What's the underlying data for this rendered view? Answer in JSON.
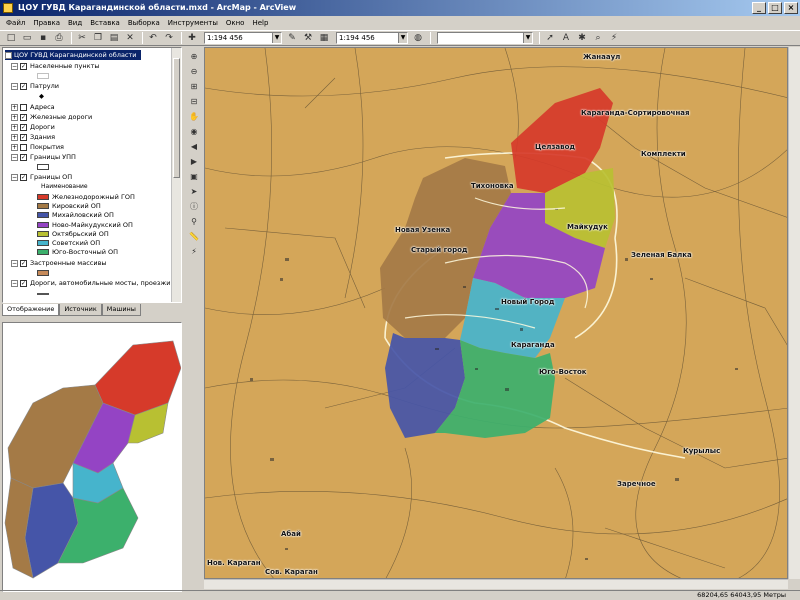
{
  "window": {
    "title": "ЦОУ ГУВД Карагандинской области.mxd - ArcMap - ArcView"
  },
  "menu": [
    "Файл",
    "Правка",
    "Вид",
    "Вставка",
    "Выборка",
    "Инструменты",
    "Окно",
    "Help"
  ],
  "toolbar": {
    "scale1": "1:194 456",
    "scale2": "1:194 456",
    "combo3": ""
  },
  "toc": {
    "root": "ЦОУ ГУВД Карагандинской области",
    "naselennye": "Населенные пункты",
    "patrul": "Патрули",
    "adresa": "Адреса",
    "zhd": "Железные дороги",
    "dorogi": "Дороги",
    "zdaniya": "Здания",
    "pokrytiya": "Покрытия",
    "granitsy_upp": "Границы УПП",
    "granitsy_op": "Границы ОП",
    "naimenovanie": "Наименование",
    "legend": [
      {
        "label": "Железнодорожный ГОП",
        "color": "#d63a2a"
      },
      {
        "label": "Кировский ОП",
        "color": "#a47a46"
      },
      {
        "label": "Михайловский ОП",
        "color": "#4555a8"
      },
      {
        "label": "Ново-Майкудукский ОП",
        "color": "#9444c4"
      },
      {
        "label": "Октябрьский ОП",
        "color": "#b8c032"
      },
      {
        "label": "Советский ОП",
        "color": "#46b4cc"
      },
      {
        "label": "Юго-Восточный ОП",
        "color": "#3cb06c"
      }
    ],
    "zastroennye": "Застроенные массивы",
    "dorogi_mosty": "Дороги, автомобильные мосты, проезжи"
  },
  "tabs": {
    "display": "Отображение",
    "source": "Источник",
    "machines": "Машины"
  },
  "map_labels": {
    "zhanaaul": "Жанааул",
    "karaganda_sort": "Караганда-Сортировочная",
    "tsentrozavod": "Целзавод",
    "komplekt": "Комплекти",
    "tikhonovka": "Тихоновка",
    "novaya_uzenka": "Новая Узенка",
    "maikuduk": "Майкудук",
    "stary_gorod": "Старый город",
    "zelenaya_balka": "Зеленая Балка",
    "novy_gorod": "Новый Город",
    "karaganda": "Караганда",
    "yugo_vostok": "Юго-Восток",
    "kurylys": "Курылыс",
    "zarechnoe": "Заречное",
    "abai": "Абай",
    "nov_karagan": "Нов. Караган",
    "sov_karagan": "Сов. Караган"
  },
  "status": {
    "coords": "68204,65  64043,95 Метры"
  },
  "colors": {
    "map_bg": "#d4a659",
    "zhd": "#d63a2a",
    "kirov": "#a47a46",
    "mikh": "#4555a8",
    "novomaik": "#9444c4",
    "oktyabr": "#b8c032",
    "sovet": "#46b4cc",
    "yugovost": "#3cb06c"
  }
}
